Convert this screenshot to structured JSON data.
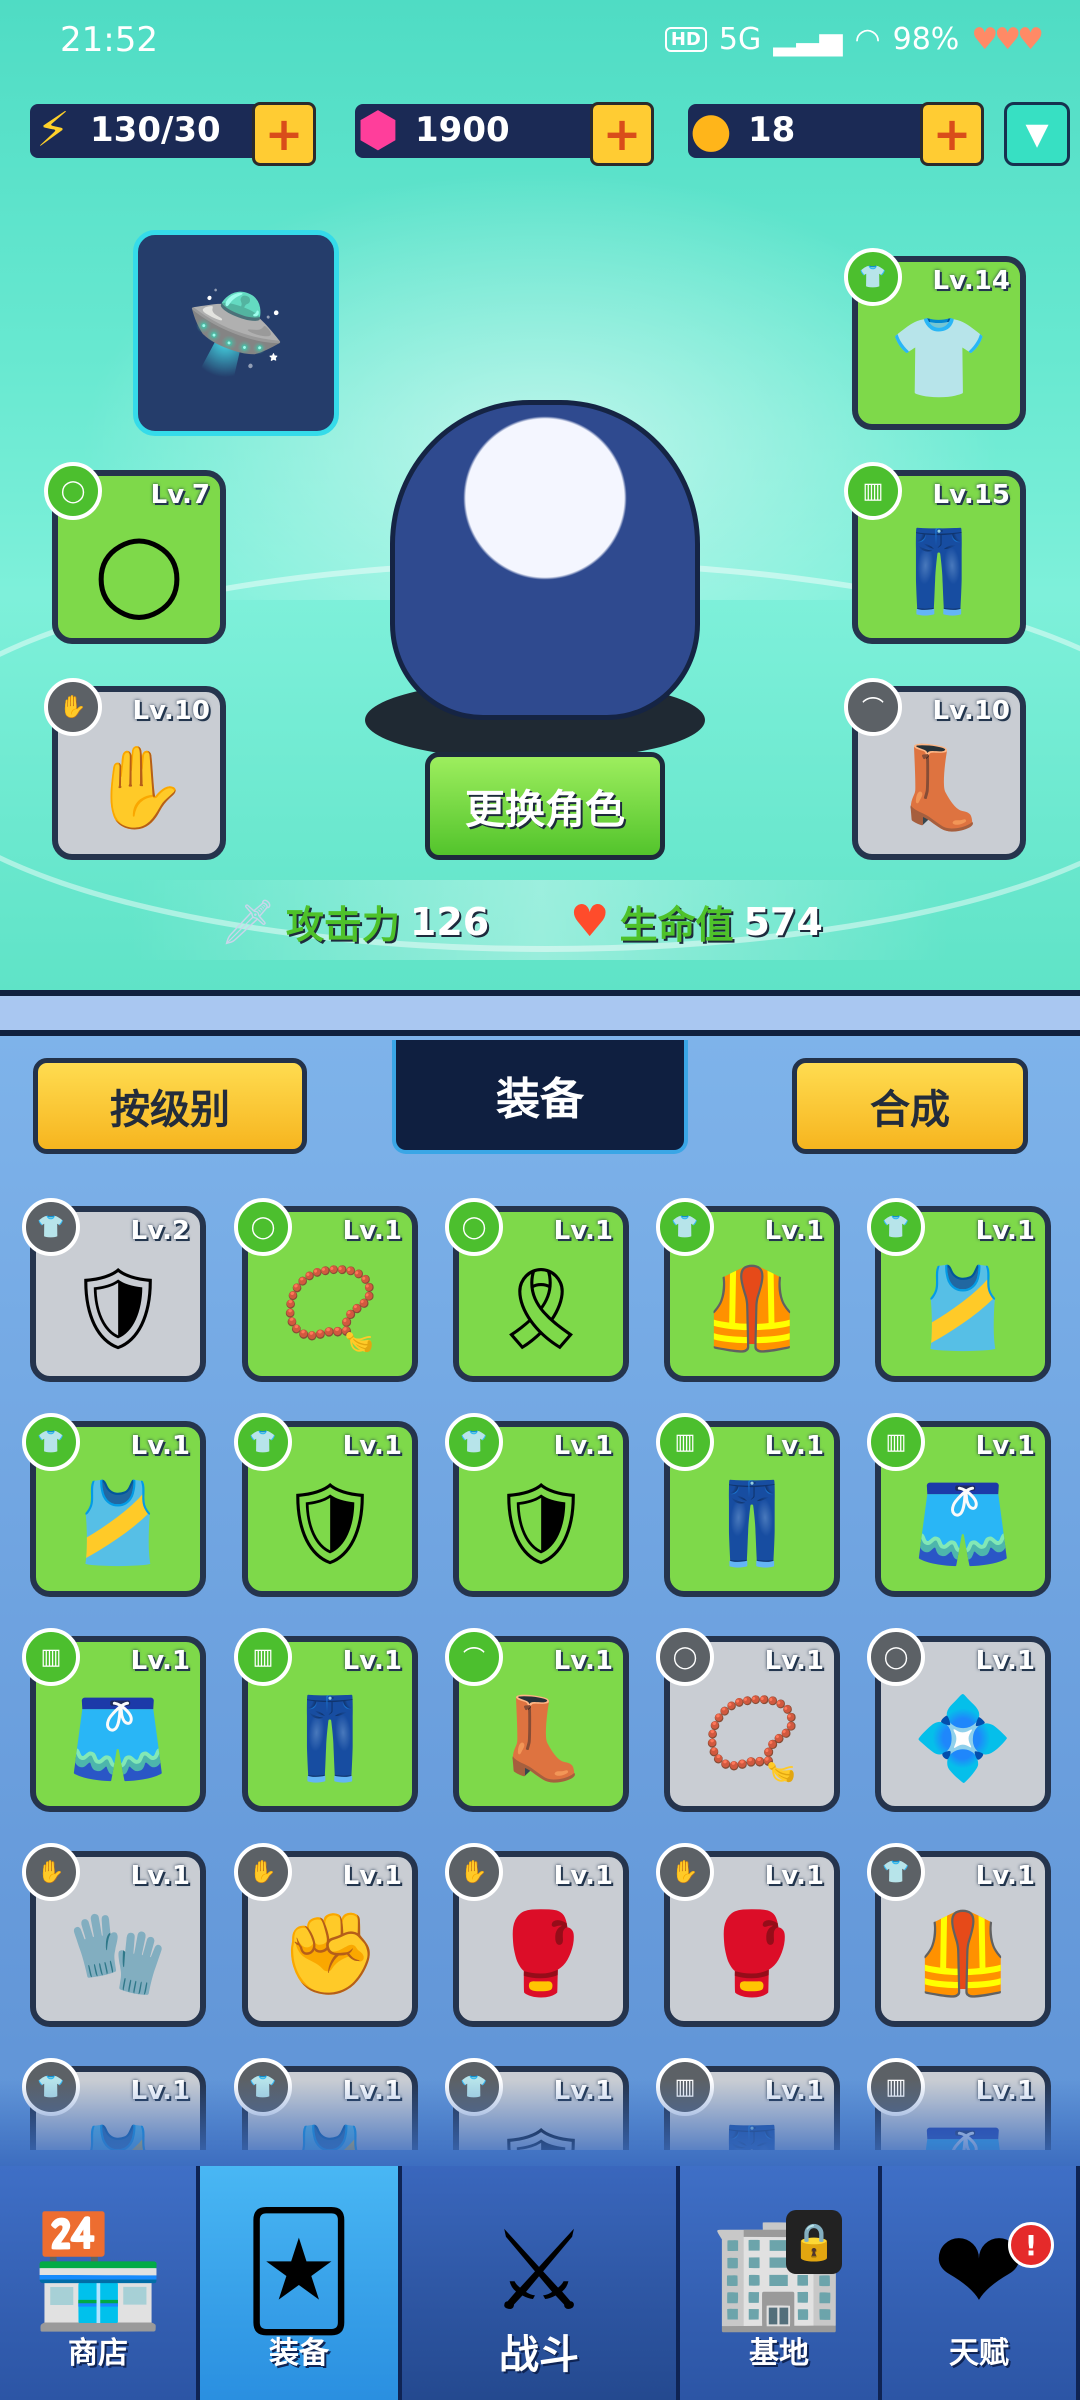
{
  "status_bar": {
    "time": "21:52",
    "hd": "HD",
    "network": "5G",
    "battery": "98%",
    "hearts": "♥♥♥"
  },
  "resources": {
    "energy": {
      "value": "130/30",
      "icon": "lightning-icon",
      "color": "#ffd12a"
    },
    "gems": {
      "value": "1900",
      "icon": "gem-icon",
      "color": "#ff3e9b"
    },
    "coins": {
      "value": "18",
      "icon": "coin-icon",
      "color": "#ffb51a"
    }
  },
  "hero": {
    "change_button": "更换角色",
    "attack_label": "攻击力",
    "attack_value": "126",
    "hp_label": "生命值",
    "hp_value": "574"
  },
  "equipped": {
    "pet": {
      "icon": "drone-pet-icon"
    },
    "left": [
      {
        "slot": "necklace",
        "level": "Lv.7",
        "rarity": "green",
        "art": "◯"
      },
      {
        "slot": "gloves",
        "level": "Lv.10",
        "rarity": "gray",
        "art": "✋"
      }
    ],
    "right": [
      {
        "slot": "shirt",
        "level": "Lv.14",
        "rarity": "green",
        "art": "👕"
      },
      {
        "slot": "pants",
        "level": "Lv.15",
        "rarity": "green",
        "art": "👖"
      },
      {
        "slot": "boots",
        "level": "Lv.10",
        "rarity": "gray",
        "art": "👢"
      }
    ]
  },
  "panel": {
    "sort_button": "按级别",
    "title": "装备",
    "merge_button": "合成"
  },
  "inventory": [
    {
      "slot": "armor",
      "level": "Lv.2",
      "rarity": "gray",
      "art": "🛡"
    },
    {
      "slot": "necklace",
      "level": "Lv.1",
      "rarity": "green",
      "art": "📿"
    },
    {
      "slot": "necklace",
      "level": "Lv.1",
      "rarity": "green",
      "art": "🎗"
    },
    {
      "slot": "armor",
      "level": "Lv.1",
      "rarity": "green",
      "art": "🦺"
    },
    {
      "slot": "armor",
      "level": "Lv.1",
      "rarity": "green",
      "art": "🎽"
    },
    {
      "slot": "armor",
      "level": "Lv.1",
      "rarity": "green",
      "art": "🎽"
    },
    {
      "slot": "armor",
      "level": "Lv.1",
      "rarity": "green",
      "art": "🛡"
    },
    {
      "slot": "armor",
      "level": "Lv.1",
      "rarity": "green",
      "art": "🛡"
    },
    {
      "slot": "pants",
      "level": "Lv.1",
      "rarity": "green",
      "art": "👖"
    },
    {
      "slot": "pants",
      "level": "Lv.1",
      "rarity": "green",
      "art": "🩳"
    },
    {
      "slot": "pants",
      "level": "Lv.1",
      "rarity": "green",
      "art": "🩳"
    },
    {
      "slot": "pants",
      "level": "Lv.1",
      "rarity": "green",
      "art": "👖"
    },
    {
      "slot": "boots",
      "level": "Lv.1",
      "rarity": "green",
      "art": "👢"
    },
    {
      "slot": "necklace",
      "level": "Lv.1",
      "rarity": "gray",
      "art": "📿"
    },
    {
      "slot": "necklace",
      "level": "Lv.1",
      "rarity": "gray",
      "art": "💠"
    },
    {
      "slot": "gloves",
      "level": "Lv.1",
      "rarity": "gray",
      "art": "🧤"
    },
    {
      "slot": "gloves",
      "level": "Lv.1",
      "rarity": "gray",
      "art": "✊"
    },
    {
      "slot": "gloves",
      "level": "Lv.1",
      "rarity": "gray",
      "art": "🥊"
    },
    {
      "slot": "gloves",
      "level": "Lv.1",
      "rarity": "gray",
      "art": "🥊"
    },
    {
      "slot": "armor",
      "level": "Lv.1",
      "rarity": "gray",
      "art": "🦺"
    },
    {
      "slot": "armor",
      "level": "Lv.1",
      "rarity": "gray",
      "art": "🎽"
    },
    {
      "slot": "armor",
      "level": "Lv.1",
      "rarity": "gray",
      "art": "🎽"
    },
    {
      "slot": "armor",
      "level": "Lv.1",
      "rarity": "gray",
      "art": "🛡"
    },
    {
      "slot": "pants",
      "level": "Lv.1",
      "rarity": "gray",
      "art": "👖"
    },
    {
      "slot": "pants",
      "level": "Lv.1",
      "rarity": "gray",
      "art": "🩳"
    }
  ],
  "nav": [
    {
      "label": "商店",
      "icon": "shop-icon",
      "glyph": "🏪"
    },
    {
      "label": "装备",
      "icon": "cards-icon",
      "glyph": "🃏"
    },
    {
      "label": "战斗",
      "icon": "battle-emblem-icon",
      "glyph": "⚔"
    },
    {
      "label": "基地",
      "icon": "base-locked-icon",
      "glyph": "🏢"
    },
    {
      "label": "天赋",
      "icon": "talent-heart-icon",
      "glyph": "❤"
    }
  ],
  "nav_alert": "!",
  "colors": {
    "green_rarity": "#7ed94a",
    "gray_rarity": "#c9cdd3",
    "accent_yellow": "#ffcc33",
    "panel_blue": "#7eb3ea",
    "nav_blue": "#2c55a5"
  }
}
